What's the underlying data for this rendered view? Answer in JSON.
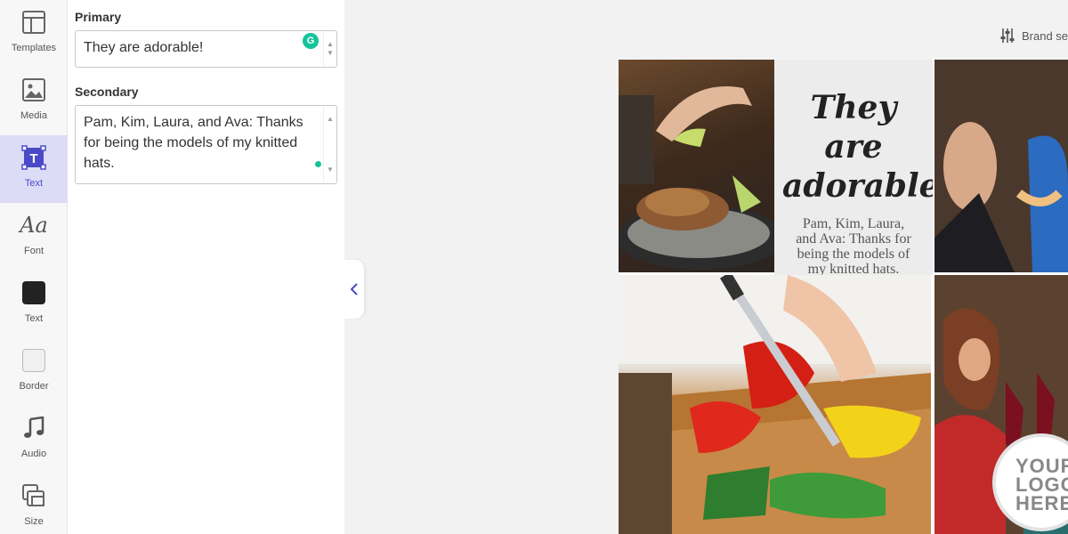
{
  "rail": {
    "items": [
      {
        "label": "Templates",
        "icon": "templates-icon"
      },
      {
        "label": "Media",
        "icon": "image-icon"
      },
      {
        "label": "Text",
        "icon": "text-tool-icon",
        "active": true
      },
      {
        "label": "Font",
        "icon": "font-icon",
        "glyph": "Aa"
      },
      {
        "label": "Text",
        "icon": "text-color-swatch",
        "color": "#222222"
      },
      {
        "label": "Border",
        "icon": "border-color-swatch",
        "color": "#f0f0f0"
      },
      {
        "label": "Audio",
        "icon": "music-note-icon"
      },
      {
        "label": "Size",
        "icon": "resize-icon"
      }
    ]
  },
  "panel": {
    "primary_label": "Primary",
    "primary_value": "They are adorable!",
    "secondary_label": "Secondary",
    "secondary_value": "Pam, Kim, Laura, and Ava: Thanks for being the models of my knitted hats."
  },
  "header": {
    "brand_settings_label": "Brand se"
  },
  "canvas": {
    "headline": "They are adorable!",
    "body": "Pam, Kim, Laura, and Ava: Thanks for being the models of my knitted hats.",
    "logo_lines": [
      "YOUR",
      "LOGO",
      "HERE"
    ]
  },
  "colors": {
    "accent": "#4a4ac8",
    "active_bg": "#dcdcf6",
    "grammarly": "#15c39a"
  }
}
